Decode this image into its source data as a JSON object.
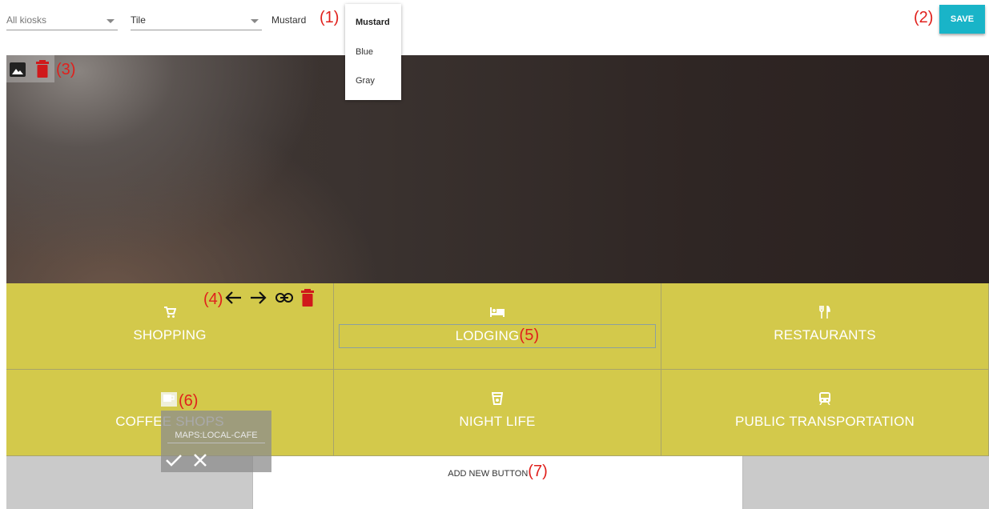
{
  "topbar": {
    "kiosk_select": "All kiosks",
    "type_select": "Tile",
    "color_select": "Mustard",
    "color_options": [
      "Mustard",
      "Blue",
      "Gray"
    ],
    "save_label": "SAVE"
  },
  "annotations": {
    "a1": "(1)",
    "a2": "(2)",
    "a3": "(3)",
    "a4": "(4)",
    "a5": "(5)",
    "a6": "(6)",
    "a7": "(7)"
  },
  "tiles": [
    {
      "label": "SHOPPING",
      "icon": "cart-icon"
    },
    {
      "label": "LODGING",
      "icon": "bed-icon"
    },
    {
      "label": "RESTAURANTS",
      "icon": "fork-knife-icon"
    },
    {
      "label": "COFFEE SHOPS",
      "icon": "coffee-icon"
    },
    {
      "label": "NIGHT LIFE",
      "icon": "drink-icon"
    },
    {
      "label": "PUBLIC TRANSPORTATION",
      "icon": "train-icon"
    }
  ],
  "link_editor": {
    "value": "MAPS:LOCAL-CAFE"
  },
  "add_button_label": "ADD NEW BUTTON",
  "colors": {
    "tile": "#d3c94b",
    "save": "#19b4c8",
    "annotation": "#e0201c",
    "delete": "#d0191b"
  }
}
